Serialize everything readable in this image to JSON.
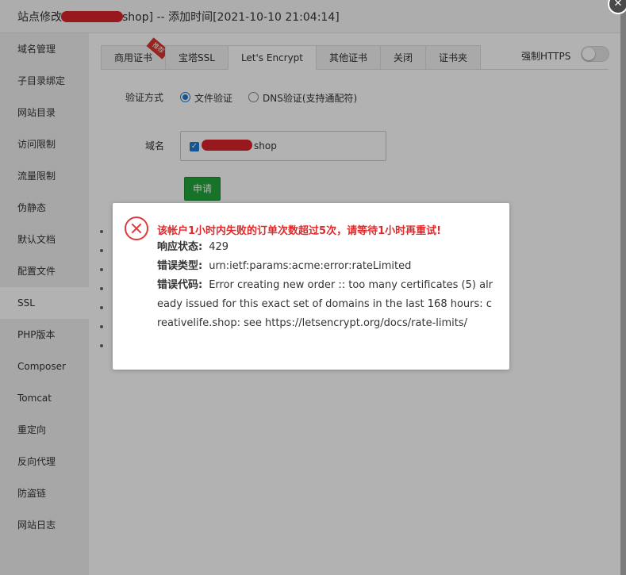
{
  "title": {
    "prefix": "站点修改",
    "suffix": "shop] -- 添加时间[2021-10-10 21:04:14]"
  },
  "close_label": "✕",
  "sidebar": {
    "items": [
      {
        "label": "域名管理"
      },
      {
        "label": "子目录绑定"
      },
      {
        "label": "网站目录"
      },
      {
        "label": "访问限制"
      },
      {
        "label": "流量限制"
      },
      {
        "label": "伪静态"
      },
      {
        "label": "默认文档"
      },
      {
        "label": "配置文件"
      },
      {
        "label": "SSL"
      },
      {
        "label": "PHP版本"
      },
      {
        "label": "Composer"
      },
      {
        "label": "Tomcat"
      },
      {
        "label": "重定向"
      },
      {
        "label": "反向代理"
      },
      {
        "label": "防盗链"
      },
      {
        "label": "网站日志"
      }
    ],
    "active": "SSL"
  },
  "tabs": [
    {
      "label": "商用证书",
      "badge": "推荐"
    },
    {
      "label": "宝塔SSL"
    },
    {
      "label": "Let's Encrypt"
    },
    {
      "label": "其他证书"
    },
    {
      "label": "关闭"
    },
    {
      "label": "证书夹"
    }
  ],
  "active_tab": "Let's Encrypt",
  "force_https": {
    "label": "强制HTTPS",
    "enabled": false
  },
  "verify": {
    "label": "验证方式",
    "options": [
      {
        "label": "文件验证",
        "checked": true
      },
      {
        "label": "DNS验证(支持通配符)",
        "checked": false
      }
    ]
  },
  "domain": {
    "label": "域名",
    "value": "shop",
    "checked": true
  },
  "apply_button": "申请",
  "error_dialog": {
    "title": "该帐户1小时内失败的订单次数超过5次，请等待1小时再重试!",
    "status_label": "响应状态:",
    "status_value": "429",
    "type_label": "错误类型:",
    "type_value": "urn:ietf:params:acme:error:rateLimited",
    "code_label": "错误代码:",
    "code_value": "Error creating new order :: too many certificates (5) already issued for this exact set of domains in the last 168 hours: creativelife.shop: see https://letsencrypt.org/docs/rate-limits/"
  },
  "colors": {
    "error": "#e0292b",
    "primary_green": "#20a53a",
    "radio_blue": "#1e7ad2"
  }
}
